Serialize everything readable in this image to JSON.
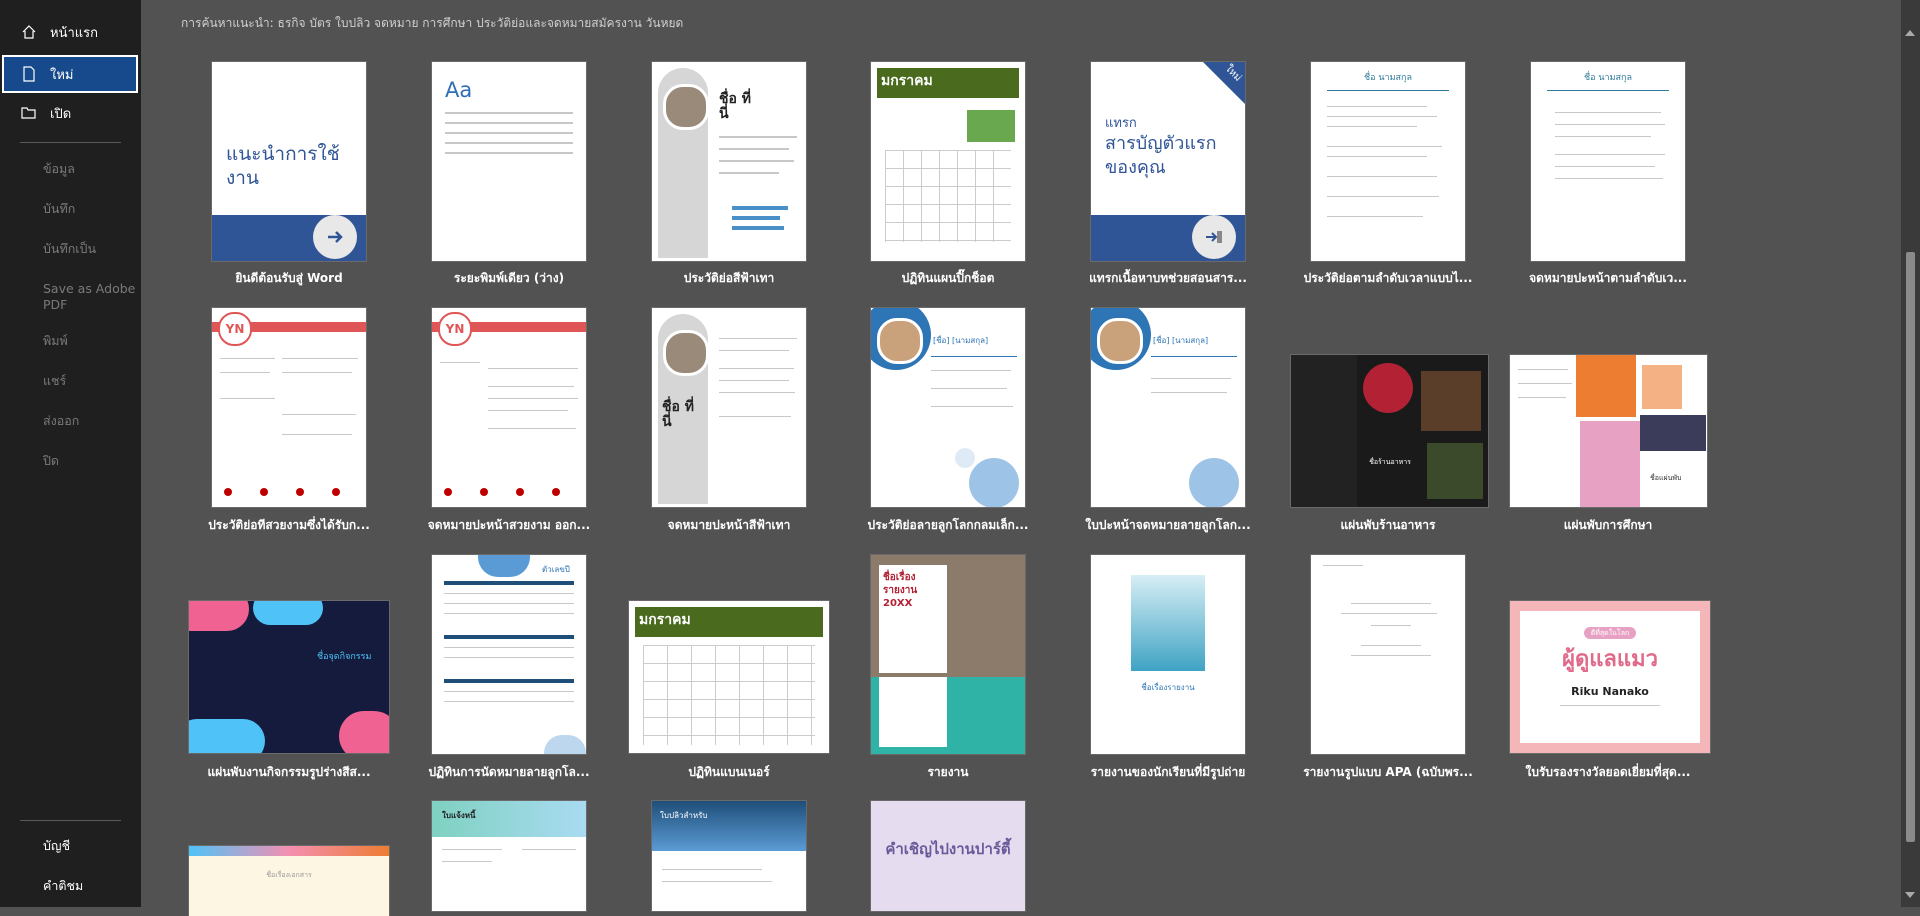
{
  "sidebar": {
    "home": "หน้าแรก",
    "new": "ใหม่",
    "open": "เปิด",
    "info": "ข้อมูล",
    "save": "บันทึก",
    "save_as": "บันทึกเป็น",
    "save_adobe": "Save as Adobe PDF",
    "print": "พิมพ์",
    "share": "แชร์",
    "export": "ส่งออก",
    "close": "ปิด",
    "account": "บัญชี",
    "feedback": "คำติชม"
  },
  "filters": "การค้นหาแนะนำ:   ธุรกิจ     บัตร     ใบปลิว     จดหมาย     การศึกษา     ประวัติย่อและจดหมายสมัครงาน     วันหยุด",
  "templates": [
    {
      "label": "ยินดีต้อนรับสู่ Word",
      "text": "แนะนำการใช้งาน"
    },
    {
      "label": "ระยะพิมพ์เดียว (ว่าง)",
      "text": "Aa"
    },
    {
      "label": "ประวัติย่อสีฟ้าเทา",
      "text": "ชื่อ ที่นี่"
    },
    {
      "label": "ปฏิทินแผนปิ๊กช็อต",
      "text": "มกราคม"
    },
    {
      "label": "แทรกเนื้อหาบทช่วยสอนสาร...",
      "text": "สารบัญตัวแรกของคุณ",
      "kicker": "แทรก",
      "badge": "ใหม่"
    },
    {
      "label": "ประวัติย่อตามลำดับเวลาแบบไ...",
      "text": "ชื่อ นามสกุล"
    },
    {
      "label": "จดหมายปะหน้าตามลำดับเว...",
      "text": "ชื่อ นามสกุล"
    },
    {
      "label": "ประวัติย่อทีสวยงามซึ่งได้รับก...",
      "text": "YN"
    },
    {
      "label": "จดหมายปะหน้าสวยงาม ออก...",
      "text": "YN"
    },
    {
      "label": "จดหมายปะหน้าสีฟ้าเทา",
      "text": "ชื่อ ที่นี่"
    },
    {
      "label": "ประวัติย่อลายลูกโลกกลมเล็ก...",
      "text": "[ชื่อ] [นามสกุล]"
    },
    {
      "label": "ใบปะหน้าจดหมายลายลูกโลก...",
      "text": "[ชื่อ] [นามสกุล]"
    },
    {
      "label": "แผ่นพับร้านอาหาร",
      "text": "ชื่อร้านอาหาร"
    },
    {
      "label": "แผ่นพับการศึกษา",
      "text": "ชื่อแผ่นพับ"
    },
    {
      "label": "แผ่นพับงานกิจกรรมรูปร่างสีส...",
      "text": "ชื่อจุดกิจกรรม"
    },
    {
      "label": "ปฏิทินการนัดหมายลายลูกโล...",
      "text": "ตัวเลขปี"
    },
    {
      "label": "ปฏิทินแบนเนอร์",
      "text": "มกราคม"
    },
    {
      "label": "รายงาน",
      "text": "ชื่อเรื่องรายงาน 20XX"
    },
    {
      "label": "รายงานของนักเรียนที่มีรูปถ่าย",
      "text": "ชื่อเรื่องรายงาน"
    },
    {
      "label": "รายงานรูปแบบ APA (ฉบับพร...",
      "text": ""
    },
    {
      "label": "ใบรับรองรางวัลยอดเยี่ยมที่สุด...",
      "text": "ผู้ดูแลแมว",
      "name": "Riku Nanako",
      "kicker": "ดีที่สุดในโลก"
    },
    {
      "label": "",
      "text": "ชื่อเรื่องเอกสาร"
    },
    {
      "label": "",
      "text": "ใบแจ้งหนี้"
    },
    {
      "label": "",
      "text": "ใบปลิวสำหรับ"
    },
    {
      "label": "",
      "text": "คำเชิญไปงานปาร์ตี้"
    }
  ]
}
